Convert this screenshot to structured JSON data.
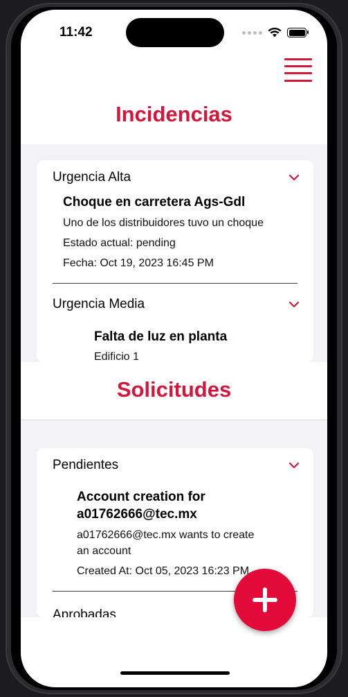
{
  "status_bar": {
    "time": "11:42"
  },
  "colors": {
    "accent": "#d4163c",
    "fab": "#e20a38",
    "band": "#f2f2f7"
  },
  "incidencias": {
    "title": "Incidencias",
    "groups": [
      {
        "label": "Urgencia Alta",
        "items": [
          {
            "title": "Choque en carretera Ags-Gdl",
            "description": "Uno de los distribuidores tuvo un choque",
            "status": "Estado actual: pending",
            "date": "Fecha: Oct 19, 2023 16:45 PM"
          }
        ]
      },
      {
        "label": "Urgencia Media",
        "items": [
          {
            "title": "Falta de luz en planta",
            "description": "Edificio 1"
          }
        ]
      }
    ]
  },
  "solicitudes": {
    "title": "Solicitudes",
    "groups": [
      {
        "label": "Pendientes",
        "items": [
          {
            "title_line1": "Account creation for",
            "title_line2": "a01762666@tec.mx",
            "desc_line1": "a01762666@tec.mx wants to create",
            "desc_line2": "an account",
            "created": "Created At: Oct 05, 2023 16:23 PM"
          }
        ]
      },
      {
        "label": "Aprobadas"
      }
    ]
  },
  "icons": {
    "menu": "hamburger-menu-icon",
    "chevron": "chevron-down-icon",
    "fab": "plus-icon"
  }
}
